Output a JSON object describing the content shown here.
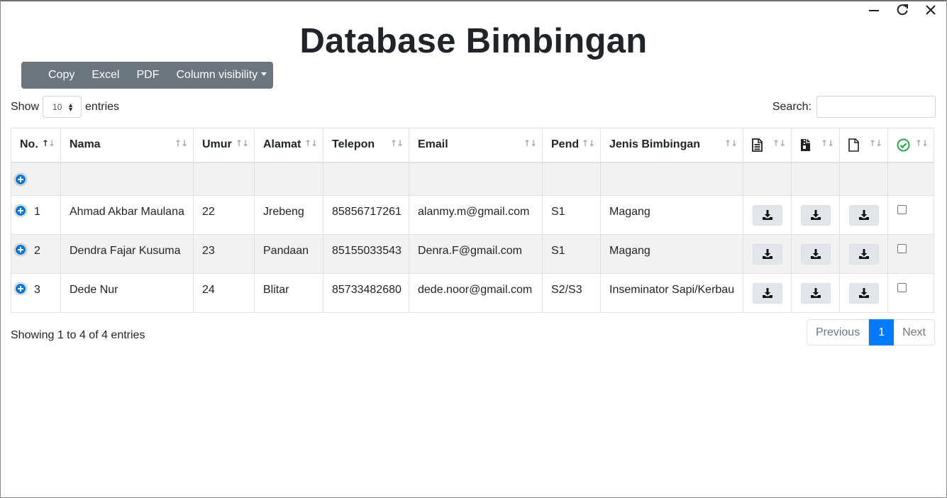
{
  "window_controls": {
    "minimize": "minimize",
    "restore": "restore",
    "close": "close"
  },
  "page": {
    "title": "Database Bimbingan"
  },
  "toolbar": {
    "buttons": [
      "Copy",
      "Excel",
      "PDF",
      "Column visibility"
    ]
  },
  "length": {
    "show_label": "Show",
    "value": "10",
    "entries_label": "entries"
  },
  "search": {
    "label": "Search:",
    "value": ""
  },
  "table": {
    "headers": [
      "No.",
      "Nama",
      "Umur",
      "Alamat",
      "Telepon",
      "Email",
      "Pend",
      "Jenis Bimbingan"
    ],
    "icon_headers": [
      "document-text-icon",
      "file-zipper-icon",
      "file-icon",
      "check-circle-icon"
    ],
    "rows": [
      {
        "no": "1",
        "nama": "Ahmad Akbar Maulana",
        "umur": "22",
        "alamat": "Jrebeng",
        "telepon": "85856717261",
        "email": "alanmy.m@gmail.com",
        "pend": "S1",
        "jenis": "Magang"
      },
      {
        "no": "2",
        "nama": "Dendra Fajar Kusuma",
        "umur": "23",
        "alamat": "Pandaan",
        "telepon": "85155033543",
        "email": "Denra.F@gmail.com",
        "pend": "S1",
        "jenis": "Magang"
      },
      {
        "no": "3",
        "nama": "Dede Nur",
        "umur": "24",
        "alamat": "Blitar",
        "telepon": "85733482680",
        "email": "dede.noor@gmail.com",
        "pend": "S2/S3",
        "jenis": "Inseminator Sapi/Kerbau"
      }
    ]
  },
  "info": {
    "text": "Showing 1 to 4 of 4 entries"
  },
  "pagination": {
    "previous": "Previous",
    "current": "1",
    "next": "Next"
  },
  "colors": {
    "toolbar_bg": "#6c757d",
    "accent": "#007bff",
    "check_green": "#28a745"
  }
}
